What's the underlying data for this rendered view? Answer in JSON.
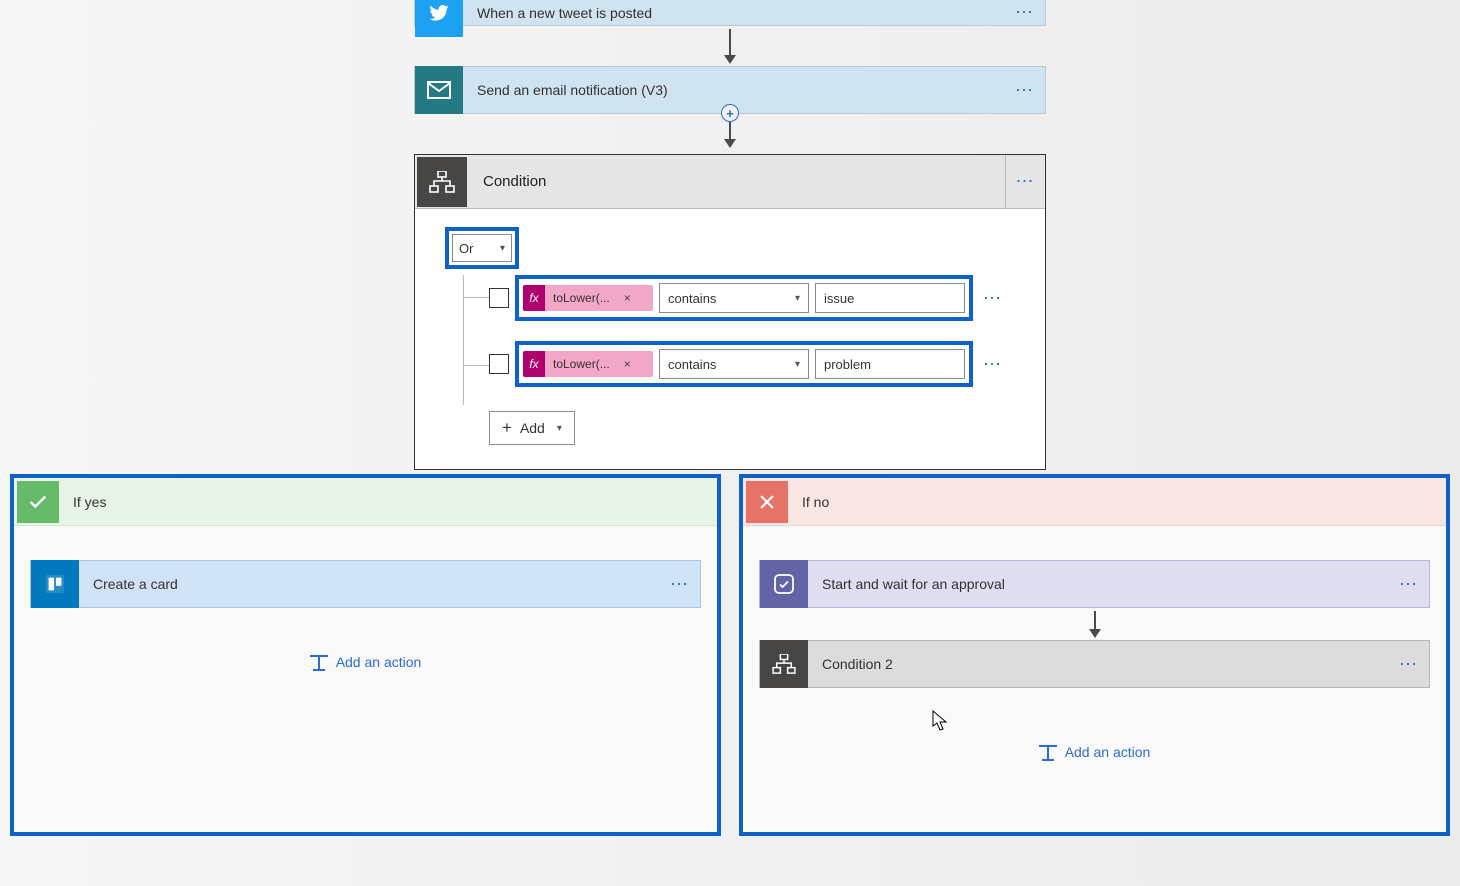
{
  "trigger": {
    "label": "When a new tweet is posted"
  },
  "email": {
    "label": "Send an email notification (V3)"
  },
  "condition": {
    "title": "Condition",
    "group_operator": "Or",
    "rows": [
      {
        "expr_label": "toLower(...",
        "op": "contains",
        "value": "issue"
      },
      {
        "expr_label": "toLower(...",
        "op": "contains",
        "value": "problem"
      }
    ],
    "add_label": "Add"
  },
  "branches": {
    "yes_label": "If yes",
    "no_label": "If no",
    "add_action_label": "Add an action",
    "yes_actions": [
      {
        "type": "trello",
        "label": "Create a card"
      }
    ],
    "no_actions": [
      {
        "type": "approval",
        "label": "Start and wait for an approval"
      },
      {
        "type": "condition",
        "label": "Condition 2"
      }
    ]
  },
  "icons": {
    "fx": "fx",
    "remove": "×",
    "plus": "+",
    "ellipsis": "⋯"
  }
}
